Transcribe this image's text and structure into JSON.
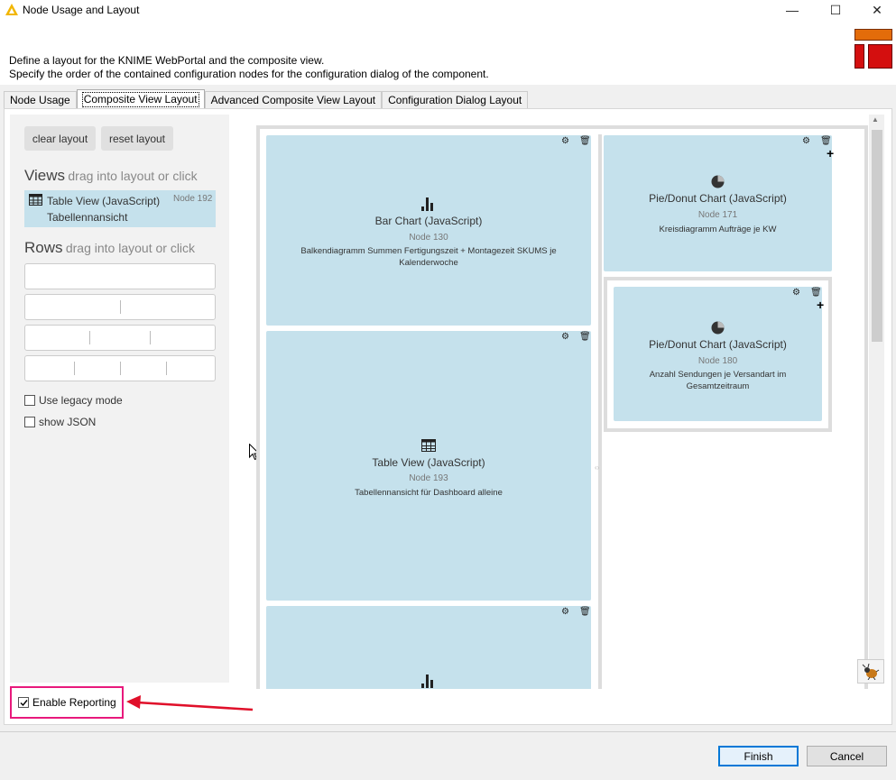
{
  "window": {
    "title": "Node Usage and Layout",
    "minimize": "—",
    "maximize": "☐",
    "close": "✕"
  },
  "header": {
    "line1": "Define a layout for the KNIME WebPortal and the composite view.",
    "line2": "Specify the order of the contained configuration nodes for the configuration dialog of the component."
  },
  "tabs": [
    {
      "label": "Node Usage"
    },
    {
      "label": "Composite View Layout"
    },
    {
      "label": "Advanced Composite View Layout"
    },
    {
      "label": "Configuration Dialog Layout"
    }
  ],
  "left": {
    "clear_label": "clear layout",
    "reset_label": "reset layout",
    "views_title": "Views",
    "views_hint": "drag into layout or click",
    "view_item": {
      "name": "Table View (JavaScript)",
      "node": "Node 192",
      "desc": "Tabellennansicht"
    },
    "rows_title": "Rows",
    "rows_hint": "drag into layout or click",
    "legacy_label": "Use legacy mode",
    "json_label": "show JSON"
  },
  "panels": {
    "bar": {
      "title": "Bar Chart (JavaScript)",
      "node": "Node 130",
      "desc": "Balkendiagramm Summen Fertigungszeit + Montagezeit SKUMS je Kalenderwoche"
    },
    "pie1": {
      "title": "Pie/Donut Chart (JavaScript)",
      "node": "Node 171",
      "desc": "Kreisdiagramm Aufträge je KW"
    },
    "pie2": {
      "title": "Pie/Donut Chart (JavaScript)",
      "node": "Node 180",
      "desc": "Anzahl Sendungen je Versandart im Gesamtzeitraum"
    },
    "table": {
      "title": "Table View (JavaScript)",
      "node": "Node 193",
      "desc": "Tabellennansicht für Dashboard alleine"
    }
  },
  "reporting": {
    "label": "Enable Reporting",
    "checked": true
  },
  "footer": {
    "finish": "Finish",
    "cancel": "Cancel"
  },
  "colors": {
    "accent_frame": "#e8197c",
    "arrow": "#e0102a",
    "panel_bg": "#c5e1ec",
    "logo_orange": "#e36c0a",
    "logo_red": "#d40f0f"
  }
}
